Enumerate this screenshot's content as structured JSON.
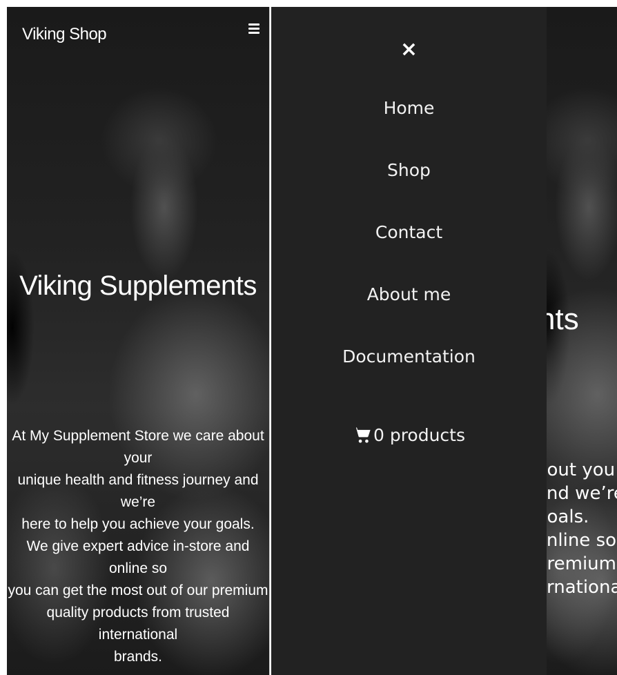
{
  "header": {
    "brand": "Viking Shop"
  },
  "hero": {
    "title": "Viking Supplements",
    "description_lines": [
      "At My Supplement Store we care about your",
      "unique health and fitness journey and we’re",
      "here to help you achieve your goals.",
      "We give expert advice in-store and online so",
      "you can get the most out of our premium",
      "quality products from trusted international",
      "brands."
    ]
  },
  "drawer": {
    "close_label": "×",
    "nav": [
      {
        "label": "Home"
      },
      {
        "label": "Shop"
      },
      {
        "label": "Contact"
      },
      {
        "label": "About me"
      },
      {
        "label": "Documentation"
      }
    ],
    "cart_label": "0 products"
  },
  "peek": {
    "title_fragment": "nts",
    "desc_fragments": [
      "bout you",
      "and we’re",
      "goals.",
      "online so",
      "premium",
      "ernational"
    ]
  },
  "icons": {
    "menu": "hamburger-icon",
    "close": "close-icon",
    "cart": "cart-icon"
  },
  "colors": {
    "drawer_bg": "#222222",
    "text": "#ffffff"
  }
}
